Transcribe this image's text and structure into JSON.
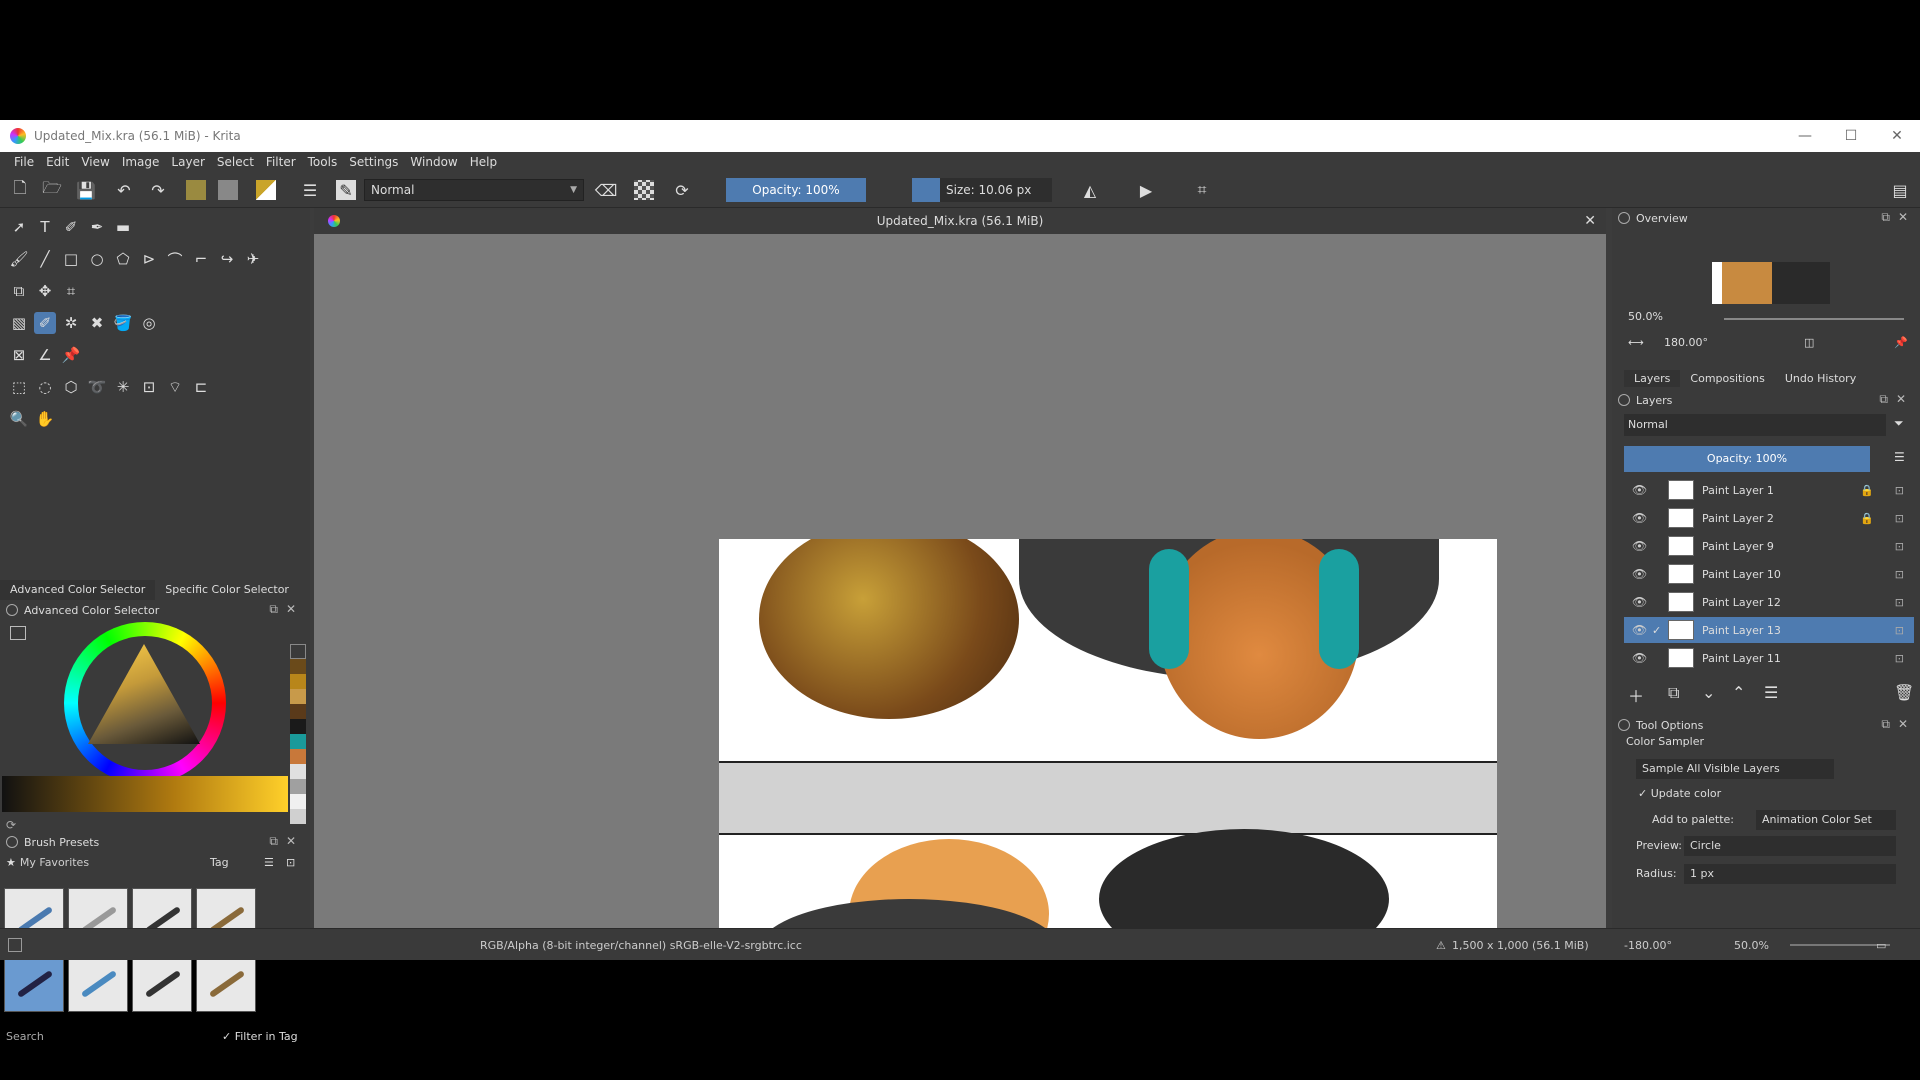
{
  "window": {
    "title": "Updated_Mix.kra (56.1 MiB) - Krita",
    "minimize": "—",
    "maximize": "☐",
    "close": "✕"
  },
  "menu": [
    "File",
    "Edit",
    "View",
    "Image",
    "Layer",
    "Select",
    "Filter",
    "Tools",
    "Settings",
    "Window",
    "Help"
  ],
  "toolbar": {
    "blend_mode": "Normal",
    "opacity": "Opacity: 100%",
    "size": "Size: 10.06 px"
  },
  "left_docker": {
    "color_tabs": [
      "Advanced Color Selector",
      "Specific Color Selector"
    ],
    "color_selector_title": "Advanced Color Selector",
    "swatches": [
      "#6a4a1a",
      "#b8861a",
      "#c89a4a",
      "#1a1a1a",
      "#1a9a9a",
      "#e0e0e0",
      "#3a3a3a",
      "#a0a0a0",
      "#f0f0f0",
      "#d0d0d0",
      "#ffffff"
    ],
    "brush_presets_title": "Brush Presets",
    "favorites": "My Favorites",
    "tag": "Tag",
    "search_placeholder": "Search",
    "filter_in_tag": "Filter in Tag"
  },
  "canvas": {
    "doc_title": "Updated_Mix.kra (56.1 MiB)",
    "close": "✕"
  },
  "overview": {
    "title": "Overview",
    "zoom": "50.0%",
    "rotation": "180.00°"
  },
  "right_tabs": [
    "Layers",
    "Compositions",
    "Undo History"
  ],
  "layers": {
    "title": "Layers",
    "blend_mode": "Normal",
    "opacity": "Opacity: 100%",
    "items": [
      {
        "name": "Paint Layer 1",
        "locked": "🔒",
        "selected": false
      },
      {
        "name": "Paint Layer 2",
        "locked": "🔒",
        "selected": false
      },
      {
        "name": "Paint Layer 9",
        "locked": "",
        "selected": false
      },
      {
        "name": "Paint Layer 10",
        "locked": "",
        "selected": false
      },
      {
        "name": "Paint Layer 12",
        "locked": "",
        "selected": false
      },
      {
        "name": "Paint Layer 13",
        "locked": "",
        "selected": true
      },
      {
        "name": "Paint Layer 11",
        "locked": "",
        "selected": false
      }
    ]
  },
  "tool_options": {
    "title": "Tool Options",
    "subtitle": "Color Sampler",
    "sample": "Sample All Visible Layers",
    "update_color": "Update color",
    "add_to_palette": "Add to palette:",
    "palette": "Animation Color Set",
    "preview_label": "Preview:",
    "preview": "Circle",
    "radius_label": "Radius:",
    "radius": "1 px"
  },
  "status": {
    "color_space": "RGB/Alpha (8-bit integer/channel)  sRGB-elle-V2-srgbtrc.icc",
    "dimensions": "1,500 x 1,000 (56.1 MiB)",
    "rotation": "-180.00°",
    "zoom": "50.0%"
  }
}
